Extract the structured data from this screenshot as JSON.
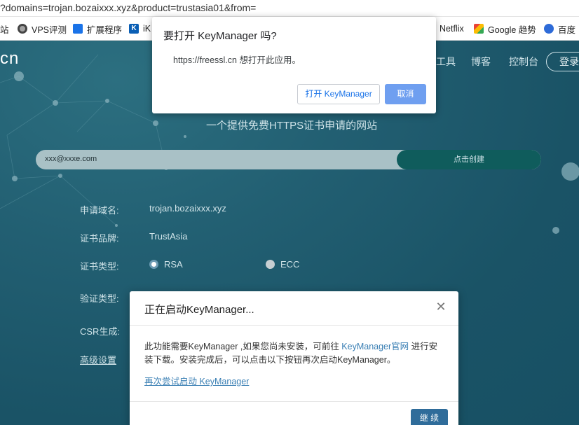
{
  "browser": {
    "url": "?domains=trojan.bozaixxx.xyz&product=trustasia01&from=",
    "bookmarks": [
      {
        "label": "站",
        "icon": "none"
      },
      {
        "label": "VPS评测",
        "icon": "globe-icon"
      },
      {
        "label": "扩展程序",
        "icon": "puzzle-icon"
      },
      {
        "label": "iK",
        "icon": "ik-icon"
      },
      {
        "label": "Netflix",
        "icon": "none"
      },
      {
        "label": "Google 趋势",
        "icon": "trends-icon"
      },
      {
        "label": "百度",
        "icon": "baidu-paw-icon"
      }
    ]
  },
  "site": {
    "logo_fragment": "cn",
    "nav": [
      "工具",
      "博客",
      "控制台"
    ],
    "login": "登录",
    "tagline": "一个提供免费HTTPS证书申请的网站",
    "email_value": "xxx@xxxe.com",
    "create_button": "点击创建",
    "form": {
      "domain_label": "申请域名:",
      "domain_value": "trojan.bozaixxx.xyz",
      "brand_label": "证书品牌:",
      "brand_value": "TrustAsia",
      "type_label": "证书类型:",
      "type_rsa": "RSA",
      "type_ecc": "ECC",
      "selected_type": "RSA",
      "verify_label": "验证类型:",
      "csr_label": "CSR生成:",
      "advanced_label": "高级设置"
    }
  },
  "external_dialog": {
    "title": "要打开 KeyManager 吗?",
    "message": "https://freessl.cn 想打开此应用。",
    "open_button": "打开 KeyManager",
    "cancel_button": "取消"
  },
  "modal": {
    "title": "正在启动KeyManager...",
    "body_part1": "此功能需要KeyManager ,如果您尚未安装，可前往 ",
    "body_link": "KeyManager官网",
    "body_part2": " 进行安装下载。安装完成后，可以点击以下按钮再次启动KeyManager。",
    "retry_link": "再次尝试启动 KeyManager",
    "continue_button": "继 续"
  },
  "colors": {
    "page_bg": "#1f5c70",
    "create_button_bg": "#0f5c5c",
    "cancel_button_bg": "#6f9ff0",
    "continue_button_bg": "#2f6c9a",
    "link": "#3a7fb4"
  }
}
